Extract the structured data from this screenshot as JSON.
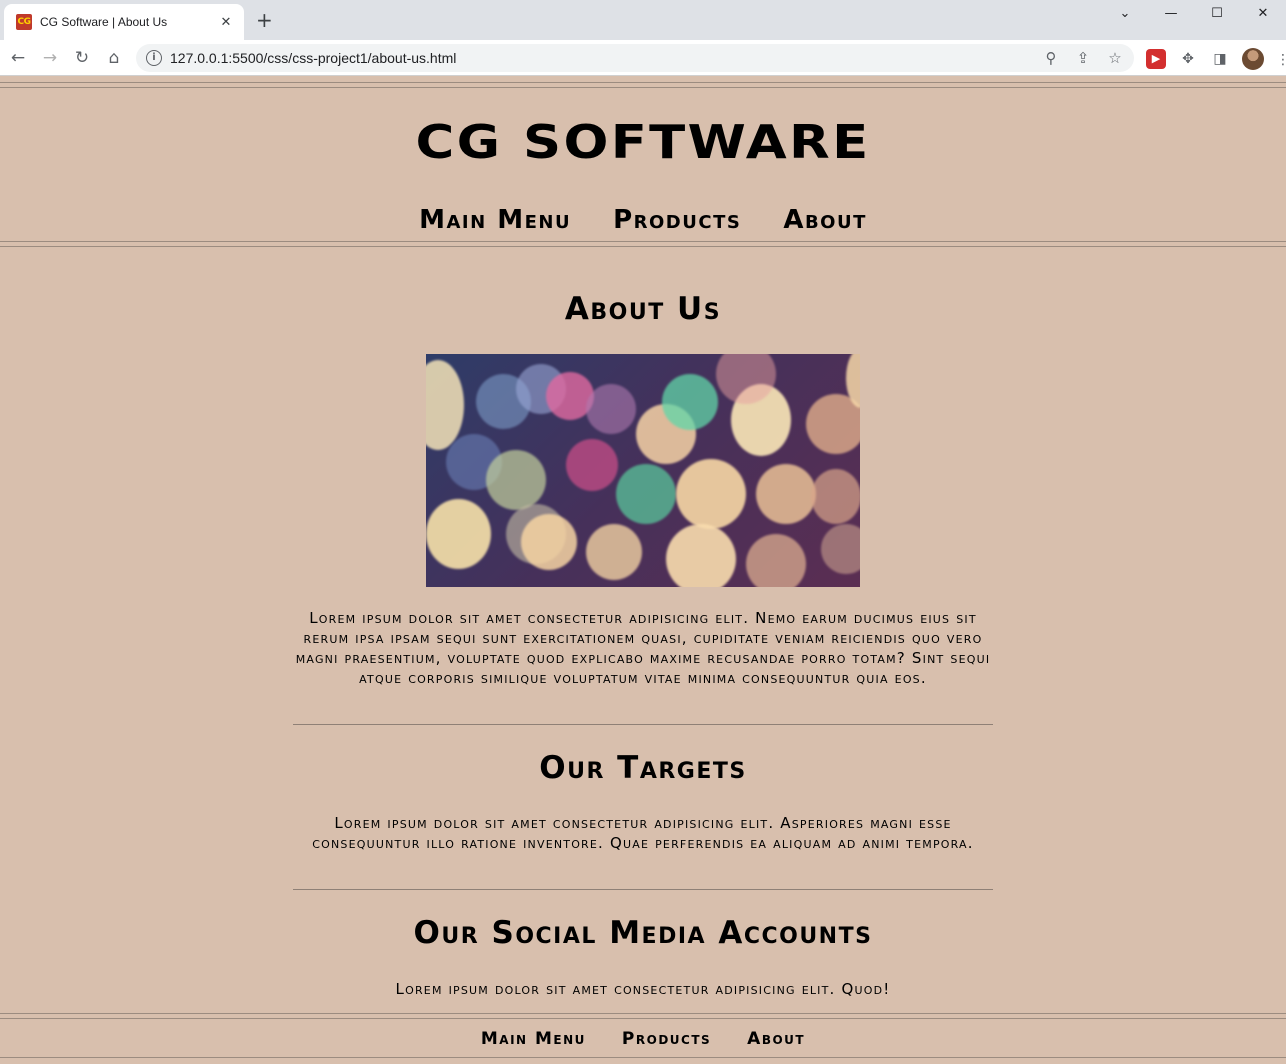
{
  "browser": {
    "tab_title": "CG Software | About Us",
    "favicon_text": "CG",
    "url": "127.0.0.1:5500/css/css-project1/about-us.html"
  },
  "site": {
    "title": "CG SOFTWARE",
    "nav": [
      "Main Menu",
      "Products",
      "About"
    ]
  },
  "sections": {
    "about_title": "About Us",
    "about_text": "Lorem ipsum dolor sit amet consectetur adipisicing elit. Nemo earum ducimus eius sit rerum ipsa ipsam sequi sunt exercitationem quasi, cupiditate veniam reiciendis quo vero magni praesentium, voluptate quod explicabo maxime recusandae porro totam? Sint sequi atque corporis similique voluptatum vitae minima consequuntur quia eos.",
    "targets_title": "Our Targets",
    "targets_text": "Lorem ipsum dolor sit amet consectetur adipisicing elit. Asperiores magni esse consequuntur illo ratione inventore. Quae perferendis ea aliquam ad animi tempora.",
    "social_title": "Our Social Media Accounts",
    "social_text": "Lorem ipsum dolor sit amet consectetur adipisicing elit. Quod!"
  },
  "footer": {
    "nav": [
      "Main Menu",
      "Products",
      "About"
    ]
  },
  "colors": {
    "page_bg": "#d8bfad",
    "text": "#000000"
  }
}
